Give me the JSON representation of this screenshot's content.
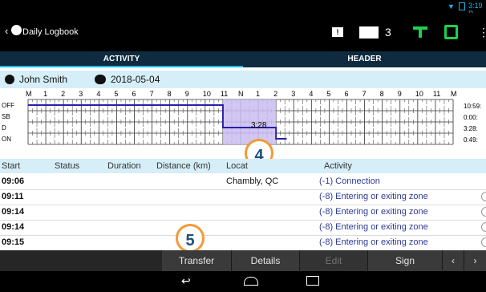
{
  "status_bar": {
    "time": "3:19 P"
  },
  "app_bar": {
    "title": "Daily Logbook",
    "message_count": "3"
  },
  "tabs": [
    {
      "label": "ACTIVITY"
    },
    {
      "label": "HEADER"
    }
  ],
  "driver": {
    "name": "John Smith",
    "date": "2018-05-04"
  },
  "chart": {
    "hour_labels": [
      "M",
      "1",
      "2",
      "3",
      "4",
      "5",
      "6",
      "7",
      "8",
      "9",
      "10",
      "11",
      "N",
      "1",
      "2",
      "3",
      "4",
      "5",
      "6",
      "7",
      "8",
      "9",
      "10",
      "11",
      "M"
    ],
    "row_labels": [
      "OFF",
      "SB",
      "D",
      "ON"
    ],
    "totals": [
      "10:59:",
      "0:00:",
      "3:28:",
      "0:49:"
    ],
    "highlight_label": "3:28"
  },
  "table": {
    "headers": {
      "start": "Start",
      "status": "Status",
      "duration": "Duration",
      "distance": "Distance (km)",
      "location": "Locat",
      "activity": "Activity"
    },
    "rows": [
      {
        "time": "09:06",
        "location": "Chambly, QC",
        "activity": "(-1) Connection"
      },
      {
        "time": "09:11",
        "location": "",
        "activity": "(-8) Entering or exiting zone"
      },
      {
        "time": "09:14",
        "location": "",
        "activity": "(-8) Entering or exiting zone"
      },
      {
        "time": "09:14",
        "location": "",
        "activity": "(-8) Entering or exiting zone"
      },
      {
        "time": "09:15",
        "location": "",
        "activity": "(-8) Entering or exiting zone"
      }
    ]
  },
  "actions": {
    "transfer": "Transfer",
    "details": "Details",
    "edit": "Edit",
    "sign": "Sign"
  },
  "callouts": {
    "four": "4",
    "five": "5"
  },
  "colors": {
    "accent": "#19b6ea",
    "truck": "#1fd04a",
    "callout_ring": "#f39a35",
    "tabs_bg": "#0f2b40"
  }
}
